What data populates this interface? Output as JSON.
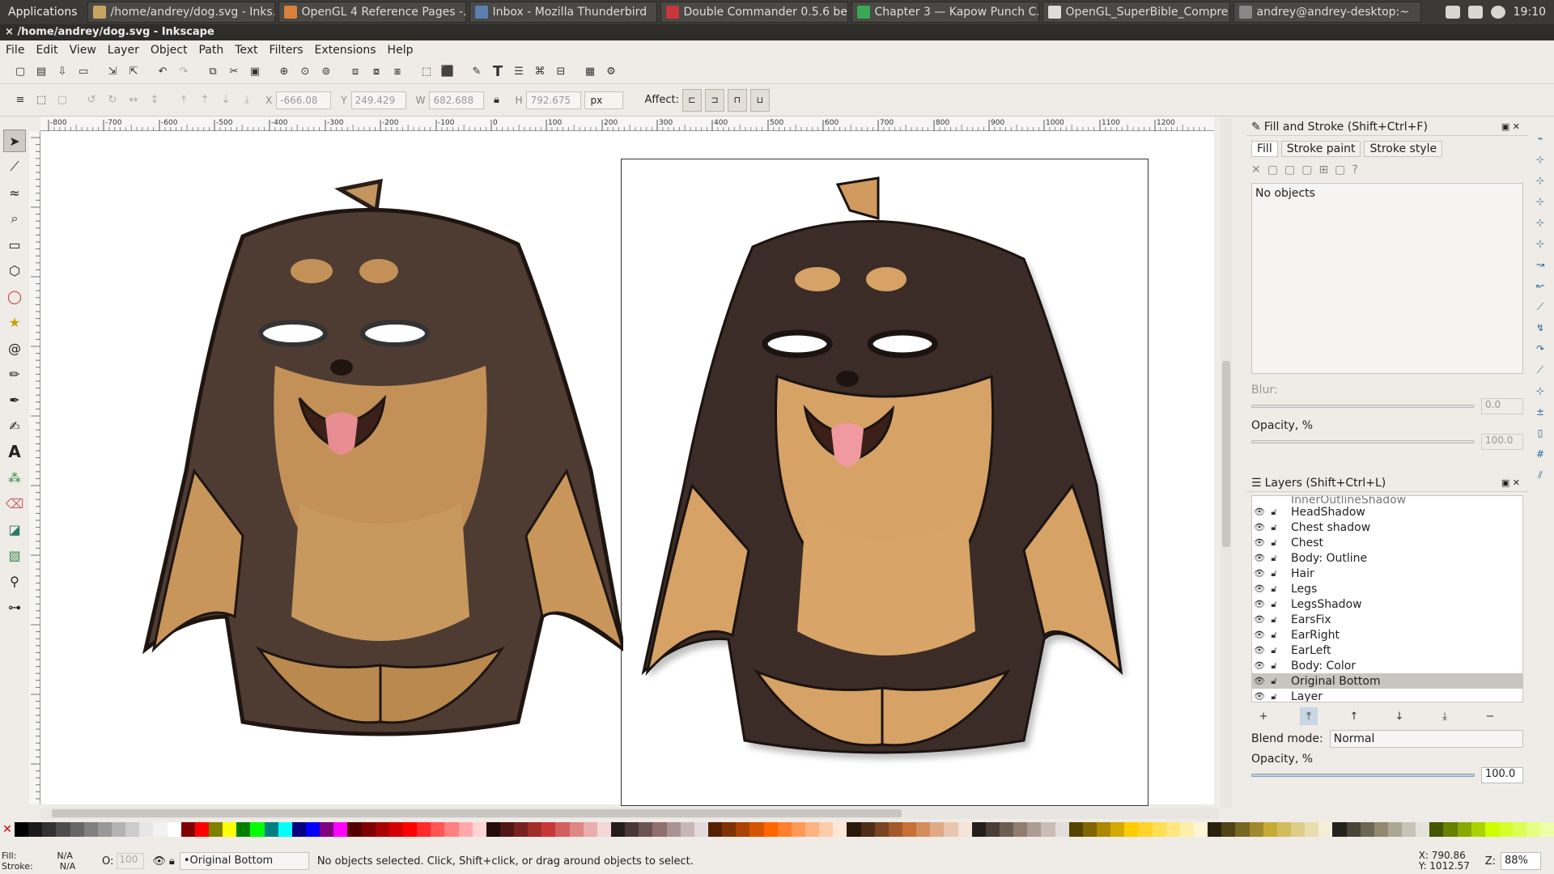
{
  "taskbar": {
    "applications": "Applications",
    "tasks": [
      {
        "label": "/home/andrey/dog.svg - Inks...",
        "color": "#c7a561"
      },
      {
        "label": "OpenGL 4 Reference Pages -...",
        "color": "#d9813a"
      },
      {
        "label": "Inbox - Mozilla Thunderbird",
        "color": "#5a7fb0"
      },
      {
        "label": "Double Commander 0.5.6 be...",
        "color": "#c8363a"
      },
      {
        "label": "Chapter 3 — Kapow Punch C...",
        "color": "#3aa855"
      },
      {
        "label": "OpenGL_SuperBible_Compre...",
        "color": "#dddddd"
      },
      {
        "label": "andrey@andrey-desktop:~",
        "color": "#888888"
      }
    ],
    "clock": "19:10"
  },
  "window": {
    "title": "/home/andrey/dog.svg - Inkscape",
    "close": "×"
  },
  "menu": [
    "File",
    "Edit",
    "View",
    "Layer",
    "Object",
    "Path",
    "Text",
    "Filters",
    "Extensions",
    "Help"
  ],
  "controls": {
    "x_label": "X",
    "x_value": "-666.08",
    "y_label": "Y",
    "y_value": "249.429",
    "w_label": "W",
    "w_value": "682.688",
    "h_label": "H",
    "h_value": "792.675",
    "unit": "px",
    "affect": "Affect:"
  },
  "ruler_ticks": [
    "-800",
    "-700",
    "-600",
    "-500",
    "-400",
    "-300",
    "-200",
    "-100",
    "0",
    "100",
    "200",
    "300",
    "400",
    "500",
    "600",
    "700",
    "800",
    "900",
    "1000",
    "1100",
    "1200"
  ],
  "fill_stroke": {
    "title": "Fill and Stroke (Shift+Ctrl+F)",
    "tabs": [
      "Fill",
      "Stroke paint",
      "Stroke style"
    ],
    "no_objects": "No objects",
    "blur_label": "Blur:",
    "blur_value": "0.0",
    "opacity_label": "Opacity, %",
    "opacity_value": "100.0"
  },
  "layers": {
    "title": "Layers (Shift+Ctrl+L)",
    "partial_top": "InnerOutlineShadow",
    "items": [
      "HeadShadow",
      "Chest shadow",
      "Chest",
      "Body: Outline",
      "Hair",
      "Legs",
      "LegsShadow",
      "EarsFix",
      "EarRight",
      "EarLeft",
      "Body: Color",
      "Original Bottom",
      "Layer"
    ],
    "selected_index": 11,
    "blend_label": "Blend mode:",
    "blend_value": "Normal",
    "opacity_label": "Opacity, %",
    "opacity_value": "100.0"
  },
  "status": {
    "fill_label": "Fill:",
    "fill_value": "N/A",
    "stroke_label": "Stroke:",
    "stroke_value": "N/A",
    "o_label": "O:",
    "o_value": "100",
    "layer": "•Original Bottom",
    "message": "No objects selected. Click, Shift+click, or drag around objects to select.",
    "x_readout": "X:   790.86",
    "y_readout": "Y: 1012.57",
    "z_label": "Z:",
    "zoom": "88%"
  },
  "palette": [
    "#000000",
    "#1a1a1a",
    "#333333",
    "#4d4d4d",
    "#666666",
    "#808080",
    "#999999",
    "#b3b3b3",
    "#cccccc",
    "#e6e6e6",
    "#f2f2f2",
    "#ffffff",
    "#800000",
    "#ff0000",
    "#808000",
    "#ffff00",
    "#008000",
    "#00ff00",
    "#008080",
    "#00ffff",
    "#000080",
    "#0000ff",
    "#800080",
    "#ff00ff",
    "#550000",
    "#800000",
    "#aa0000",
    "#d40000",
    "#ff0000",
    "#ff2a2a",
    "#ff5555",
    "#ff8080",
    "#ffaaaa",
    "#ffd5d5",
    "#280b0b",
    "#501616",
    "#782121",
    "#a02c2c",
    "#c83737",
    "#d35f5f",
    "#de8787",
    "#e9afaf",
    "#f4d7d7",
    "#241c1c",
    "#483737",
    "#6c5353",
    "#916f6f",
    "#ac9393",
    "#c8b7b7",
    "#e3dbdb",
    "#552200",
    "#803300",
    "#aa4400",
    "#d45500",
    "#ff6600",
    "#ff7f2a",
    "#ff9955",
    "#ffb380",
    "#ffccaa",
    "#ffe6d5",
    "#28170b",
    "#502d16",
    "#784421",
    "#a05a2c",
    "#c87137",
    "#d38d5f",
    "#deaa87",
    "#e9c6af",
    "#f4e3d7",
    "#241f1c",
    "#483e37",
    "#6c5d53",
    "#917c6f",
    "#ac9d93",
    "#c8beb7",
    "#e3dedb",
    "#554400",
    "#806600",
    "#aa8800",
    "#d4aa00",
    "#ffcc00",
    "#ffd42a",
    "#ffdd55",
    "#ffe680",
    "#ffeeaa",
    "#fff6d5",
    "#28220b",
    "#504416",
    "#786721",
    "#a0892c",
    "#c8ab37",
    "#d3bc5f",
    "#decd87",
    "#e9ddaf",
    "#f4eed7",
    "#24221c",
    "#484537",
    "#6c6753",
    "#918a6f",
    "#aca793",
    "#c8c4b7",
    "#e3e2db",
    "#445500",
    "#668000",
    "#88aa00",
    "#aad400",
    "#ccff00",
    "#d4ff2a",
    "#ddff55",
    "#e5ff80",
    "#eeffaa"
  ]
}
